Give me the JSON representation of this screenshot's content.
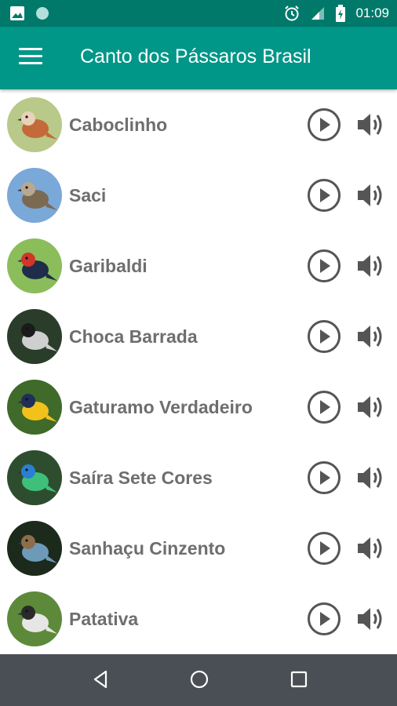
{
  "status_bar": {
    "time": "01:09",
    "icons": [
      "image-icon",
      "circle-icon",
      "alarm-icon",
      "signal-icon",
      "battery-icon"
    ]
  },
  "app_bar": {
    "title": "Canto dos Pássaros Brasil",
    "menu_icon": "hamburger-menu-icon"
  },
  "birds": [
    {
      "name": "Caboclinho",
      "colors": [
        "#b8c98a",
        "#c46a3a",
        "#e8d2b8"
      ]
    },
    {
      "name": "Saci",
      "colors": [
        "#7aa8d8",
        "#7a6a52",
        "#b8a890"
      ]
    },
    {
      "name": "Garibaldi",
      "colors": [
        "#8bbd5a",
        "#1f2d4a",
        "#d1362a"
      ]
    },
    {
      "name": "Choca Barrada",
      "colors": [
        "#2a3d2a",
        "#cfcfcf",
        "#1b1b1b"
      ]
    },
    {
      "name": "Gaturamo Verdadeiro",
      "colors": [
        "#3f6a2a",
        "#f2c21b",
        "#1f2f5a"
      ]
    },
    {
      "name": "Saíra Sete Cores",
      "colors": [
        "#2e4d2e",
        "#3ec07a",
        "#2a7fd2"
      ]
    },
    {
      "name": "Sanhaçu Cinzento",
      "colors": [
        "#1c2a1c",
        "#6d9ab8",
        "#8d6e4a"
      ]
    },
    {
      "name": "Patativa",
      "colors": [
        "#5c8a3a",
        "#e6e6e6",
        "#2a2a2a"
      ]
    }
  ],
  "actions": {
    "play_icon": "play-circle-icon",
    "sound_icon": "volume-icon"
  },
  "nav_bar": {
    "icons": [
      "back-icon",
      "home-icon",
      "recents-icon"
    ]
  },
  "colors": {
    "primary": "#009688",
    "primary_dark": "#00796b",
    "text": "#6e6e6e",
    "icon": "#555555",
    "nav": "#4a4f55"
  }
}
